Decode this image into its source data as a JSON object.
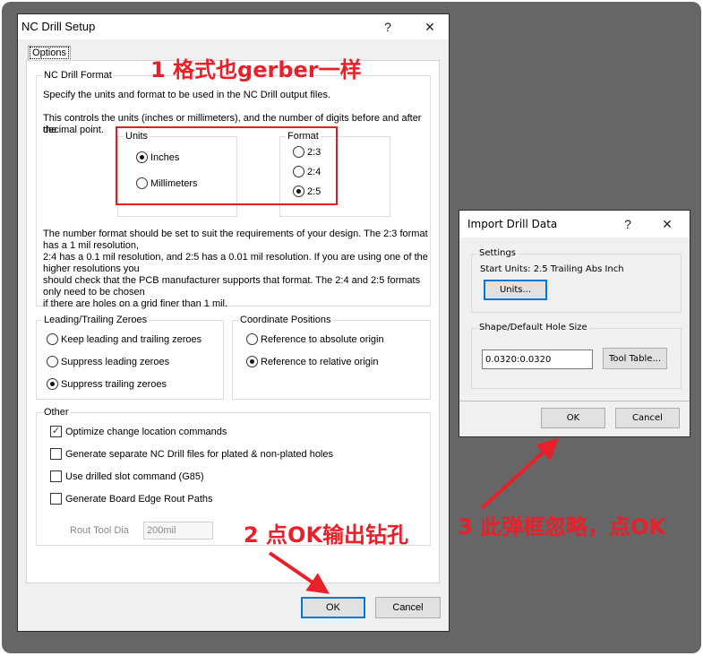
{
  "nc_dialog": {
    "title": "NC Drill Setup",
    "help_label": "?",
    "close_label": "✕",
    "tab_label": "Options",
    "format_group": {
      "label": "NC Drill Format",
      "line1": "Specify the units and format to be used in the NC Drill output files.",
      "line2a": "This controls the units (inches or millimeters), and the number of digits before and after the",
      "line2b": "decimal point.",
      "units_group_label": "Units",
      "units": [
        {
          "label": "Inches",
          "selected": true
        },
        {
          "label": "Millimeters",
          "selected": false
        }
      ],
      "format_group_label": "Format",
      "formats": [
        {
          "label": "2:3",
          "selected": false
        },
        {
          "label": "2:4",
          "selected": false
        },
        {
          "label": "2:5",
          "selected": true
        }
      ],
      "description": [
        "The number format should be set to suit the requirements of your design. The 2:3 format",
        "has a 1 mil resolution,",
        "2:4 has a 0.1 mil resolution, and 2:5 has a 0.01 mil resolution. If you are using one of the",
        "higher resolutions you",
        "should check that the PCB manufacturer supports that format. The 2:4 and 2:5 formats",
        "only need to be chosen",
        "if there are holes on a grid finer than 1 mil."
      ]
    },
    "zeroes_group": {
      "label": "Leading/Trailing Zeroes",
      "options": [
        {
          "label": "Keep leading and trailing zeroes",
          "selected": false
        },
        {
          "label": "Suppress leading zeroes",
          "selected": false
        },
        {
          "label": "Suppress trailing zeroes",
          "selected": true
        }
      ]
    },
    "coords_group": {
      "label": "Coordinate Positions",
      "options": [
        {
          "label": "Reference to absolute origin",
          "selected": false
        },
        {
          "label": "Reference to relative origin",
          "selected": true
        }
      ]
    },
    "other_group": {
      "label": "Other",
      "checks": [
        {
          "label": "Optimize change location commands",
          "checked": true
        },
        {
          "label": "Generate separate NC Drill files for plated & non-plated holes",
          "checked": false
        },
        {
          "label": "Use drilled slot command (G85)",
          "checked": false
        },
        {
          "label": "Generate Board Edge Rout Paths",
          "checked": false
        }
      ],
      "rout_tool_label": "Rout Tool Dia",
      "rout_tool_value": "200mil"
    },
    "ok_label": "OK",
    "cancel_label": "Cancel"
  },
  "import_dialog": {
    "title": "Import Drill Data",
    "help_label": "?",
    "close_label": "✕",
    "settings_label": "Settings",
    "start_units": "Start Units: 2.5 Trailing Abs Inch",
    "units_button": "Units...",
    "hole_group_label": "Shape/Default Hole Size",
    "hole_value": "0.0320:0.0320",
    "tool_table_button": "Tool Table...",
    "ok_label": "OK",
    "cancel_label": "Cancel"
  },
  "annotations": {
    "note1": "1 格式也gerber一样",
    "note2": "2 点OK输出钻孔",
    "note3": "3 此弹框忽略，点OK",
    "color": "#e8202a"
  }
}
